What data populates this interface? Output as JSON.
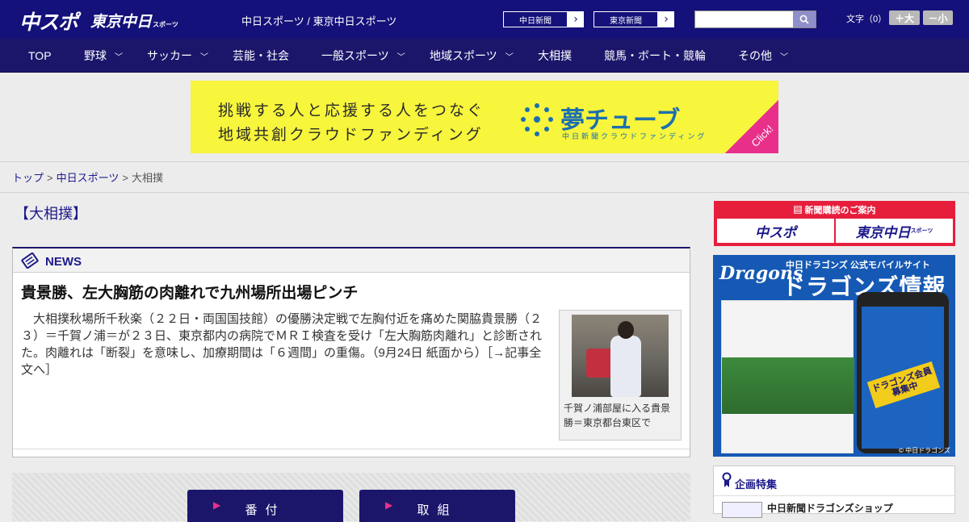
{
  "header": {
    "logo_chuspo": "中スポ",
    "logo_tokyo": "東京中日",
    "logo_tokyo_small": "スポーツ",
    "site_names": "中日スポーツ / 東京中日スポーツ",
    "links": [
      {
        "label": "中日新聞",
        "arrow": "›"
      },
      {
        "label": "東京新聞",
        "arrow": "›"
      }
    ],
    "search": {
      "placeholder": "",
      "icon": "search-icon"
    },
    "font_size_label": "文字（0）",
    "font_plus": "＋大",
    "font_minus": "－小"
  },
  "nav": {
    "items": [
      {
        "label": "TOP",
        "dropdown": false
      },
      {
        "label": "野球",
        "dropdown": true
      },
      {
        "label": "サッカー",
        "dropdown": true
      },
      {
        "label": "芸能・社会",
        "dropdown": false
      },
      {
        "label": "一般スポーツ",
        "dropdown": true
      },
      {
        "label": "地域スポーツ",
        "dropdown": true
      },
      {
        "label": "大相撲",
        "dropdown": false
      },
      {
        "label": "競馬・ボート・競輪",
        "dropdown": false
      },
      {
        "label": "その他",
        "dropdown": true
      }
    ]
  },
  "banner": {
    "line1": "挑戦する人と応援する人をつなぐ",
    "line2": "地域共創クラウドファンディング",
    "brand": "夢チューブ",
    "brand_sub": "中日新聞クラウドファンディング",
    "click": "Click!"
  },
  "breadcrumb": {
    "items": [
      "トップ",
      "中日スポーツ",
      "大相撲"
    ],
    "sep": ">"
  },
  "page": {
    "heading": "【大相撲】"
  },
  "news": {
    "label": "NEWS",
    "headline": "貴景勝、左大胸筋の肉離れで九州場所出場ピンチ",
    "body": "　大相撲秋場所千秋楽（２２日・両国国技館）の優勝決定戦で左胸付近を痛めた関脇貴景勝（２３）＝千賀ノ浦＝が２３日、東京都内の病院でＭＲＩ検査を受け「左大胸筋肉離れ」と診断された。肉離れは「断裂」を意味し、加療期間は「６週間」の重傷。（9月24日 紙面から）［→記事全文へ］",
    "caption": "千賀ノ浦部屋に入る貴景勝＝東京都台東区で"
  },
  "bottom_buttons": [
    "番付",
    "取組"
  ],
  "sidebar": {
    "subscribe_title": "新聞購読のご案内",
    "subscribe_logos": [
      "中スポ",
      "東京中日"
    ],
    "subscribe_logo_small": "スポーツ",
    "dragons": {
      "logo": "Dragons",
      "title": "中日ドラゴンズ 公式モバイルサイト",
      "big": "ドラゴンズ情報",
      "ribbon": "ドラゴンズ会員募集中",
      "copyright": "© 中日ドラゴンズ"
    },
    "feature": {
      "title": "企画特集",
      "item": "中日新聞ドラゴンズショップ"
    }
  },
  "colors": {
    "header": "#14117a",
    "nav": "#1c166b",
    "accent_red": "#e61e3c",
    "banner_yellow": "#f7f53c"
  }
}
